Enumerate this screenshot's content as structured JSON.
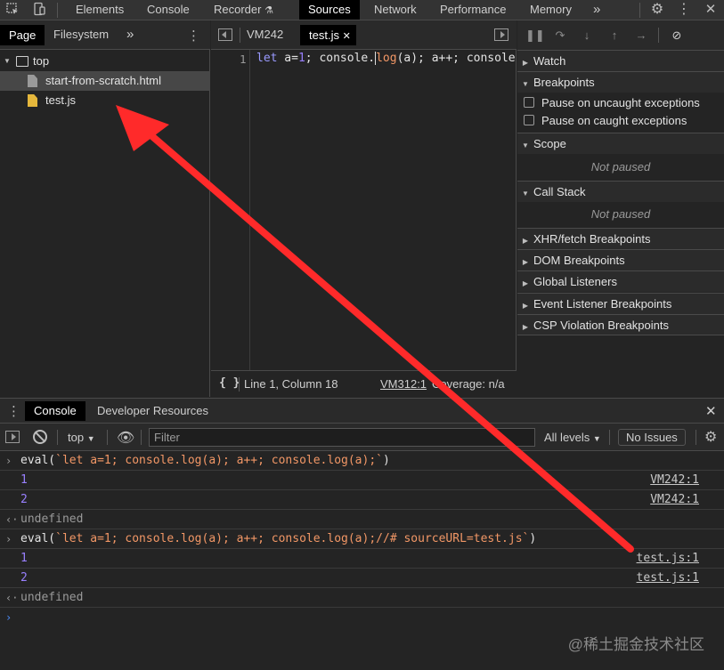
{
  "topbar": {
    "tabs": [
      "Elements",
      "Console",
      "Recorder",
      "Sources",
      "Network",
      "Performance",
      "Memory"
    ],
    "recorder_icon": "flask-icon",
    "more": "»",
    "icons": [
      "inspect-icon",
      "device-toolbar-icon",
      "gear-icon",
      "more-vert-icon",
      "close-icon"
    ]
  },
  "navigator": {
    "tabs": [
      "Page",
      "Filesystem"
    ],
    "more": "»",
    "tree": [
      {
        "label": "top",
        "icon": "frame-icon"
      },
      {
        "label": "start-from-scratch.html",
        "icon": "file-icon"
      },
      {
        "label": "test.js",
        "icon": "js-file-icon"
      }
    ]
  },
  "editor": {
    "tabs": [
      "VM242",
      "test.js"
    ],
    "line_number": "1",
    "code": {
      "kw": "let",
      "a": " a=",
      "one": "1",
      "rest1": "; console.",
      "log": "log",
      "rest2": "(a); a++; console"
    },
    "status": {
      "braces": "{ }",
      "position": "Line 1, Column 18",
      "link": "VM312:1",
      "coverage": "Coverage: n/a"
    }
  },
  "debugger": {
    "watch": "Watch",
    "breakpoints": "Breakpoints",
    "pause_uncaught": "Pause on uncaught exceptions",
    "pause_caught": "Pause on caught exceptions",
    "scope": "Scope",
    "not_paused": "Not paused",
    "call_stack": "Call Stack",
    "sections": [
      "XHR/fetch Breakpoints",
      "DOM Breakpoints",
      "Global Listeners",
      "Event Listener Breakpoints",
      "CSP Violation Breakpoints"
    ]
  },
  "drawer": {
    "tabs": [
      "Console",
      "Developer Resources"
    ]
  },
  "console_toolbar": {
    "context": "top",
    "filter_placeholder": "Filter",
    "levels": "All levels",
    "issues": "No Issues"
  },
  "console": {
    "lines": [
      {
        "type": "input",
        "eval": "eval(",
        "tpl": "`let a=1; console.log(a); a++; console.log(a);`",
        "close": ")"
      },
      {
        "type": "output",
        "text": "1",
        "src": "VM242:1"
      },
      {
        "type": "output",
        "text": "2",
        "src": "VM242:1"
      },
      {
        "type": "result",
        "text": "undefined"
      },
      {
        "type": "input",
        "eval": "eval(",
        "tpl": "`let a=1; console.log(a); a++; console.log(a);//# sourceURL=test.js`",
        "close": ")"
      },
      {
        "type": "output",
        "text": "1",
        "src": "test.js:1"
      },
      {
        "type": "output",
        "text": "2",
        "src": "test.js:1"
      },
      {
        "type": "result",
        "text": "undefined"
      }
    ],
    "prompt": "›"
  },
  "watermark": "@稀土掘金技术社区",
  "colors": {
    "arrow": "#ff2a2a",
    "active_tab_bg": "#000000",
    "number": "#9980ff",
    "string": "#f29766"
  }
}
